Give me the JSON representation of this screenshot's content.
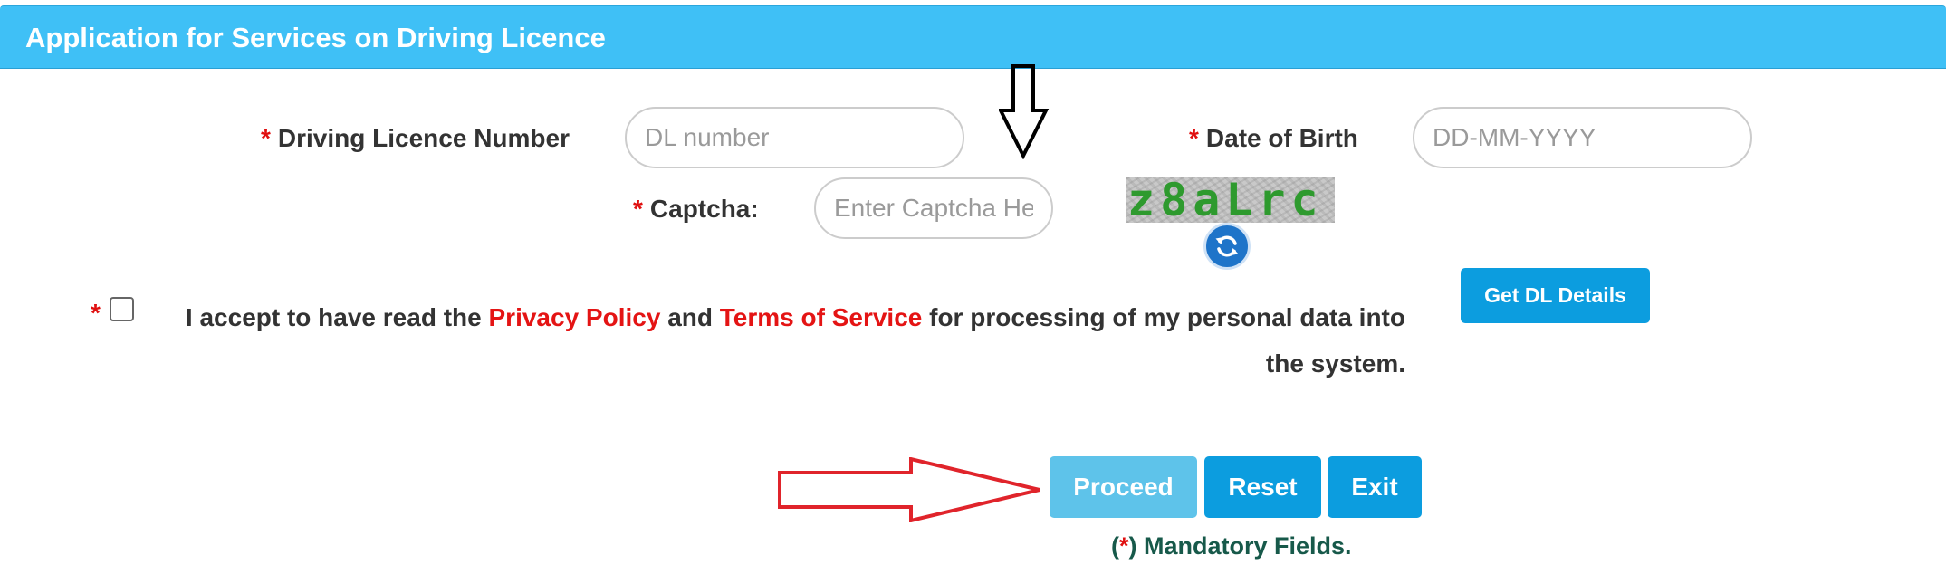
{
  "header": {
    "title": "Application for Services on Driving Licence"
  },
  "form": {
    "required_mark": "*",
    "dl_number": {
      "label": "Driving Licence Number",
      "placeholder": "DL number",
      "value": ""
    },
    "dob": {
      "label": "Date of Birth",
      "placeholder": "DD-MM-YYYY",
      "value": ""
    },
    "captcha": {
      "label": "Captcha:",
      "placeholder": "Enter Captcha Here",
      "value": "",
      "image_text": "z8aLrc",
      "refresh_icon": "refresh-icon"
    },
    "consent": {
      "checked": false,
      "text_before": "I accept to have read the",
      "privacy_link": "Privacy Policy",
      "text_and": "and",
      "terms_link": "Terms of Service",
      "text_after": "for processing of my personal data into the system."
    },
    "get_dl_details_label": "Get DL Details"
  },
  "actions": {
    "proceed_label": "Proceed",
    "reset_label": "Reset",
    "exit_label": "Exit"
  },
  "footer": {
    "mandatory_open": "(",
    "mandatory_star": "*",
    "mandatory_text": ") Mandatory Fields."
  },
  "annotations": {
    "down_arrow_icon": "arrow-down-outline-icon",
    "right_arrow_icon": "arrow-right-outline-icon"
  },
  "colors": {
    "header_bg": "#3fc0f6",
    "button_primary": "#0c9ddf",
    "button_proceed": "#5ec3ea",
    "required": "#e01010",
    "link": "#e41414",
    "mandatory_text": "#17594a",
    "captcha_text": "#2e9a2e",
    "annotation_arrow_red": "#e0242b",
    "annotation_arrow_black": "#000000"
  }
}
